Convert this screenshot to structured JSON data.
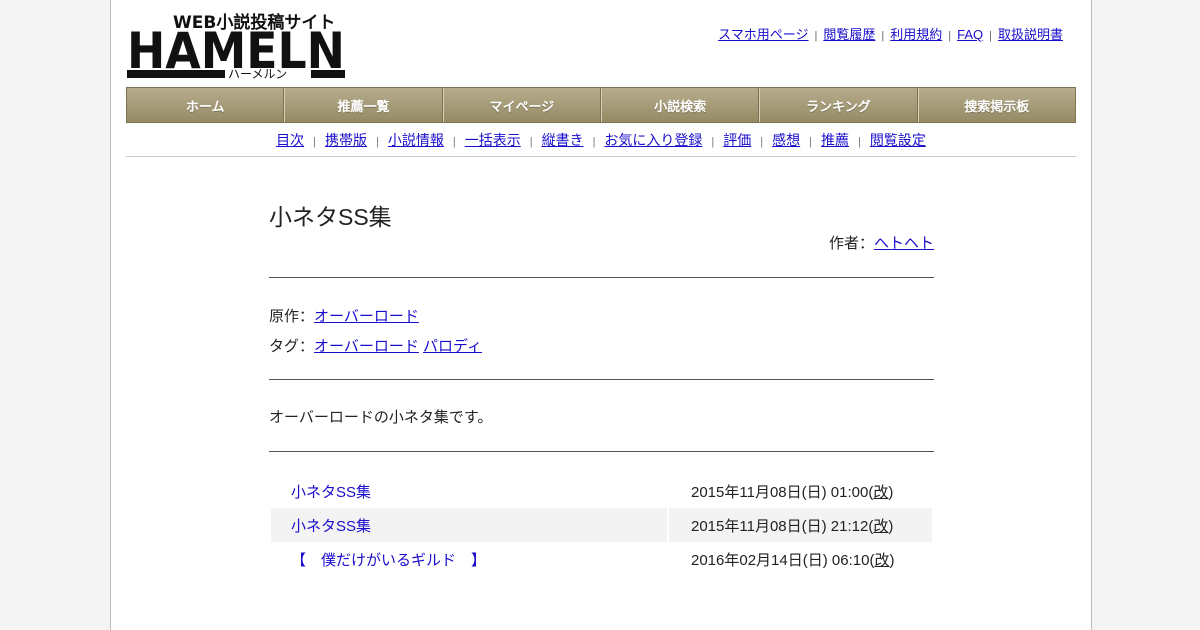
{
  "logo": {
    "big_text": "HAMELN",
    "tagline": "WEB小説投稿サイト",
    "kana": "ハーメルン"
  },
  "top_links": [
    "スマホ用ページ",
    "閲覧履歴",
    "利用規約",
    "FAQ",
    "取扱説明書"
  ],
  "top_sep": "|",
  "main_nav": [
    "ホーム",
    "推薦一覧",
    "マイページ",
    "小説検索",
    "ランキング",
    "捜索掲示板"
  ],
  "sub_nav": [
    "目次",
    "携帯版",
    "小説情報",
    "一括表示",
    "縦書き",
    "お気に入り登録",
    "評価",
    "感想",
    "推薦",
    "閲覧設定"
  ],
  "novel": {
    "title": "小ネタSS集",
    "author_label": "作者：",
    "author": "ヘトヘト",
    "original_label": "原作：",
    "original": "オーバーロード",
    "tag_label": "タグ：",
    "tags": [
      "オーバーロード",
      "パロディ"
    ],
    "description": "オーバーロードの小ネタ集です。"
  },
  "chapters": [
    {
      "title": "小ネタSS集",
      "date": "2015年11月08日(日) 01:00",
      "rev": "改"
    },
    {
      "title": "小ネタSS集",
      "date": "2015年11月08日(日) 21:12",
      "rev": "改"
    },
    {
      "title": "【　僕だけがいるギルド　】",
      "date": "2016年02月14日(日) 06:10",
      "rev": "改"
    }
  ],
  "colors": {
    "nav_gradient_top": "#b7ad8d",
    "nav_gradient_bottom": "#958a65",
    "link": "#1a0dcc",
    "logo": "#111111"
  }
}
